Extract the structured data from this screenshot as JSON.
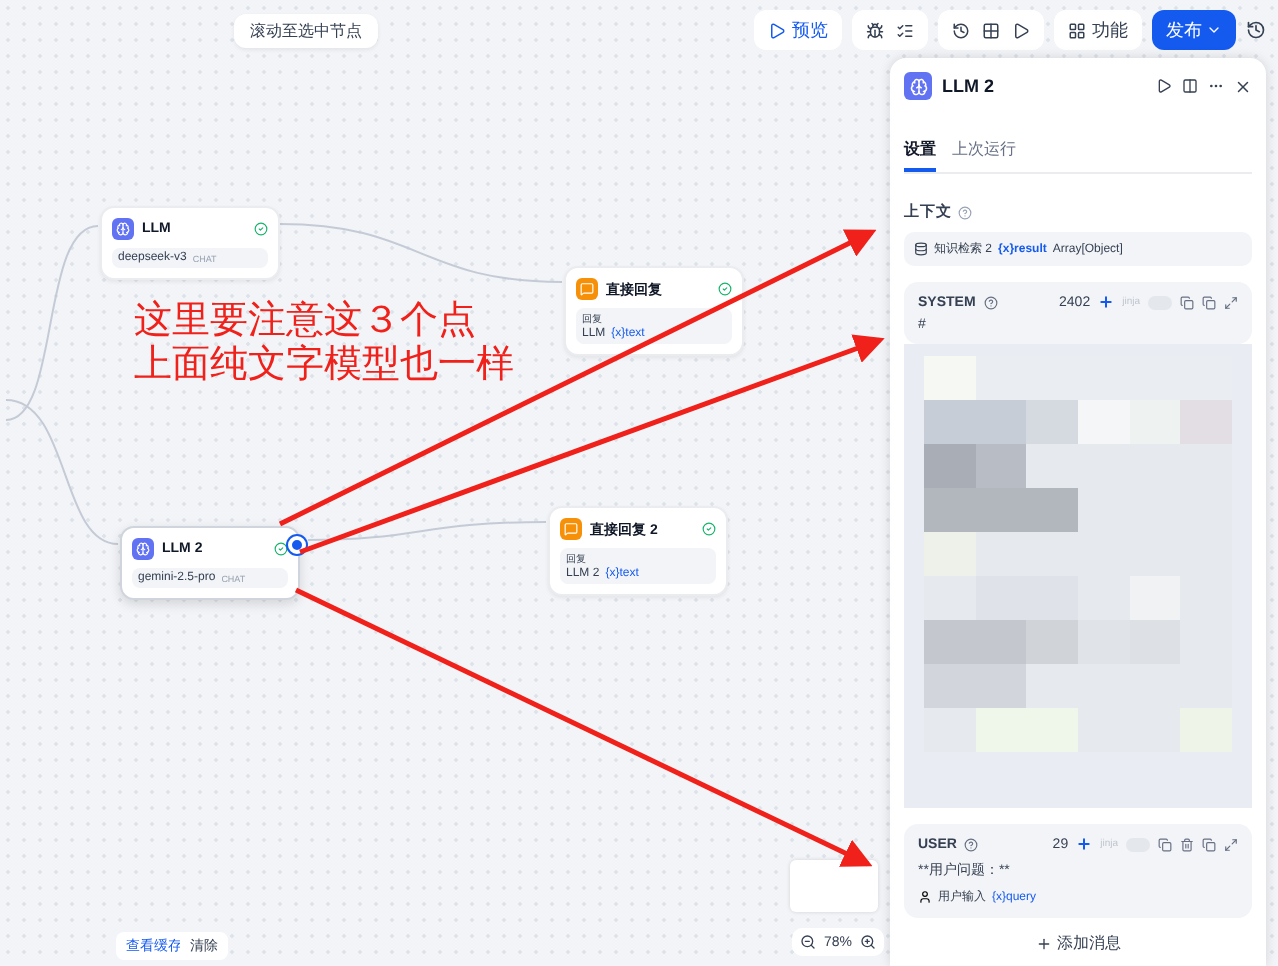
{
  "canvas_hint": "滚动至选中节点",
  "toolbar": {
    "preview": "预览",
    "features": "功能",
    "publish": "发布"
  },
  "nodes": [
    {
      "kind": "llm",
      "title": "LLM",
      "model": "deepseek-v3",
      "badge": "CHAT",
      "selected": false
    },
    {
      "kind": "reply",
      "title": "直接回复",
      "label": "回复",
      "ref": "LLM",
      "var": "{x}text"
    },
    {
      "kind": "llm",
      "title": "LLM 2",
      "model": "gemini-2.5-pro",
      "badge": "CHAT",
      "selected": true
    },
    {
      "kind": "reply",
      "title": "直接回复 2",
      "label": "回复",
      "ref": "LLM 2",
      "var": "{x}text"
    }
  ],
  "annotation": [
    "这里要注意这３个点",
    "上面纯文字模型也一样"
  ],
  "panel": {
    "title": "LLM 2",
    "tabs": [
      {
        "label": "设置",
        "selected": true
      },
      {
        "label": "上次运行",
        "selected": false
      }
    ],
    "context": {
      "label": "上下文",
      "source": "知识检索 2",
      "var": "{x}result",
      "type": "Array[Object]"
    },
    "messages": [
      {
        "role": "SYSTEM",
        "count": "2402",
        "jinja": "jinja",
        "jinja_on": false,
        "lines": [
          "#"
        ]
      },
      {
        "role": "USER",
        "count": "29",
        "jinja": "jinja",
        "jinja_on": false,
        "lines": [
          "**用户问题：**"
        ],
        "var_line": {
          "source": "用户输入",
          "var": "{x}query"
        }
      }
    ],
    "add_message": "添加消息"
  },
  "footer": {
    "cache": "查看缓存",
    "clear": "清除",
    "zoom": "78%"
  }
}
